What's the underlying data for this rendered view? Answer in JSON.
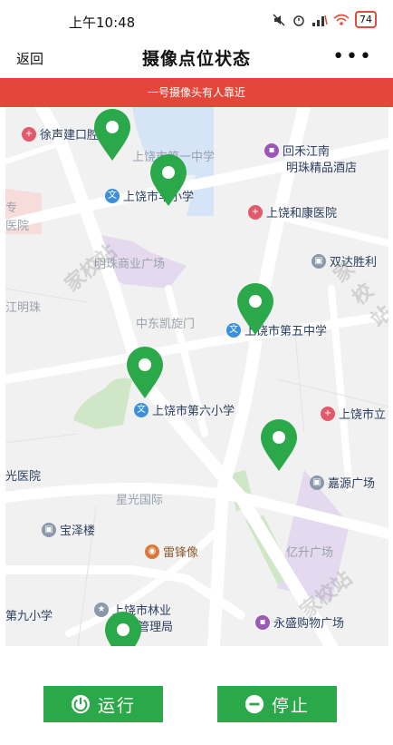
{
  "status_bar": {
    "time": "上午10:48",
    "battery": "74"
  },
  "nav": {
    "back": "返回",
    "title": "摄像点位状态",
    "more": "•••"
  },
  "alert": "一号摄像头有人靠近",
  "map": {
    "pois": {
      "xushen": "徐声建口腔",
      "yizhong": "上饶市第一中学",
      "fengxiao": "上饶市丰小学",
      "huihe": "回禾江南",
      "mingzhu": "明珠精品酒店",
      "hekang": "上饶和康医院",
      "zhuan": "专",
      "yiyuan": "医院",
      "mzsy": "明珠商业广场",
      "shuangda": "双达胜利",
      "jiangming": "江明珠",
      "kaixuan": "中东凯旋门",
      "wuzhong": "上饶市第五中学",
      "liuxiao": "上饶市第六小学",
      "shili": "上饶市立",
      "guang": "光医院",
      "jiayuan": "嘉源广场",
      "xingguang": "星光国际",
      "baoze": "宝泽楼",
      "leifeng": "雷锋像",
      "yisheng": "亿升广场",
      "jiuxiao": "第九小学",
      "linye1": "上饶市林业",
      "linye2": "发展管理局",
      "yongsheng": "永盛购物广场"
    },
    "watermark": "家校站"
  },
  "buttons": {
    "run": "运行",
    "stop": "停止"
  },
  "colors": {
    "accent": "#2aa84a",
    "alert": "#e4473a"
  }
}
